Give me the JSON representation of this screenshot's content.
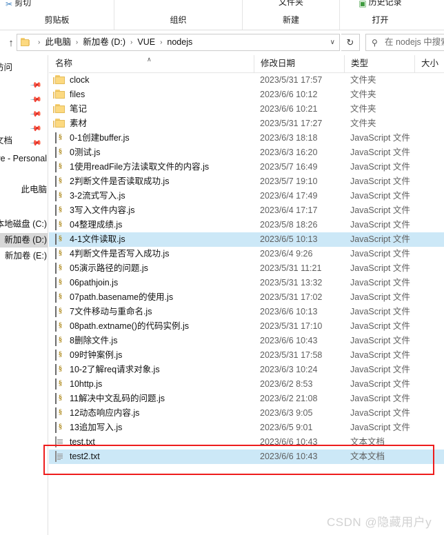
{
  "window": {
    "title": "nodejs"
  },
  "ribbon": {
    "groups": [
      {
        "label": "剪贴板",
        "command": "剪切",
        "icon": "scissors-icon"
      },
      {
        "label": "组织",
        "command": "",
        "icon": ""
      },
      {
        "label": "新建",
        "command": "文件夹",
        "icon": "folder-icon"
      },
      {
        "label": "打开",
        "command": "历史记录",
        "icon": "history-icon"
      }
    ]
  },
  "addressbar": {
    "up_tooltip": "上一级",
    "folder_icon": "folder-icon",
    "crumbs": [
      "此电脑",
      "新加卷 (D:)",
      "VUE",
      "nodejs"
    ],
    "separator": "›",
    "chevron": "∨",
    "refresh_icon": "↻"
  },
  "search": {
    "icon": "search-icon",
    "placeholder": "在 nodejs 中搜索"
  },
  "navpane": {
    "items": [
      {
        "label": "快速访问",
        "pinned": false,
        "selected": false,
        "wide": false
      },
      {
        "label": "",
        "pinned": true,
        "selected": false,
        "wide": false
      },
      {
        "label": "",
        "pinned": true,
        "selected": false,
        "wide": false
      },
      {
        "label": "",
        "pinned": true,
        "selected": false,
        "wide": false
      },
      {
        "label": "",
        "pinned": true,
        "selected": false,
        "wide": false
      },
      {
        "label": "文档",
        "pinned": true,
        "selected": false,
        "wide": false
      },
      {
        "label": "OneDrive - Personal",
        "pinned": false,
        "selected": false,
        "wide": true
      },
      {
        "label": "此电脑",
        "pinned": false,
        "selected": false,
        "wide": true
      },
      {
        "label": "本地磁盘 (C:)",
        "pinned": false,
        "selected": false,
        "wide": true
      },
      {
        "label": "新加卷 (D:)",
        "pinned": false,
        "selected": true,
        "wide": true
      },
      {
        "label": "新加卷 (E:)",
        "pinned": false,
        "selected": false,
        "wide": true
      }
    ]
  },
  "filelist": {
    "columns": [
      "名称",
      "修改日期",
      "类型",
      "大小"
    ],
    "sort_indicator": "∧",
    "rows": [
      {
        "name": "clock",
        "date": "2023/5/31 17:57",
        "type": "文件夹",
        "size": "",
        "icon": "folder-icon",
        "selected": false
      },
      {
        "name": "files",
        "date": "2023/6/6 10:12",
        "type": "文件夹",
        "size": "",
        "icon": "folder-icon",
        "selected": false
      },
      {
        "name": "笔记",
        "date": "2023/6/6 10:21",
        "type": "文件夹",
        "size": "",
        "icon": "folder-icon",
        "selected": false
      },
      {
        "name": "素材",
        "date": "2023/5/31 17:27",
        "type": "文件夹",
        "size": "",
        "icon": "folder-icon",
        "selected": false
      },
      {
        "name": "0-1创建buffer.js",
        "date": "2023/6/3 18:18",
        "type": "JavaScript 文件",
        "size": "",
        "icon": "js-file-icon",
        "selected": false
      },
      {
        "name": "0测试.js",
        "date": "2023/6/3 16:20",
        "type": "JavaScript 文件",
        "size": "",
        "icon": "js-file-icon",
        "selected": false
      },
      {
        "name": "1使用readFile方法读取文件的内容.js",
        "date": "2023/5/7 16:49",
        "type": "JavaScript 文件",
        "size": "",
        "icon": "js-file-icon",
        "selected": false
      },
      {
        "name": "2判断文件是否读取成功.js",
        "date": "2023/5/7 19:10",
        "type": "JavaScript 文件",
        "size": "",
        "icon": "js-file-icon",
        "selected": false
      },
      {
        "name": "3-2流式写入.js",
        "date": "2023/6/4 17:49",
        "type": "JavaScript 文件",
        "size": "",
        "icon": "js-file-icon",
        "selected": false
      },
      {
        "name": "3写入文件内容.js",
        "date": "2023/6/4 17:17",
        "type": "JavaScript 文件",
        "size": "",
        "icon": "js-file-icon",
        "selected": false
      },
      {
        "name": "04整理成绩.js",
        "date": "2023/5/8 18:26",
        "type": "JavaScript 文件",
        "size": "",
        "icon": "js-file-icon",
        "selected": false
      },
      {
        "name": "4-1文件读取.js",
        "date": "2023/6/5 10:13",
        "type": "JavaScript 文件",
        "size": "",
        "icon": "js-file-icon",
        "selected": true
      },
      {
        "name": "4判断文件是否写入成功.js",
        "date": "2023/6/4 9:26",
        "type": "JavaScript 文件",
        "size": "",
        "icon": "js-file-icon",
        "selected": false
      },
      {
        "name": "05演示路径的问题.js",
        "date": "2023/5/31 11:21",
        "type": "JavaScript 文件",
        "size": "",
        "icon": "js-file-icon",
        "selected": false
      },
      {
        "name": "06pathjoin.js",
        "date": "2023/5/31 13:32",
        "type": "JavaScript 文件",
        "size": "",
        "icon": "js-file-icon",
        "selected": false
      },
      {
        "name": "07path.basename的使用.js",
        "date": "2023/5/31 17:02",
        "type": "JavaScript 文件",
        "size": "",
        "icon": "js-file-icon",
        "selected": false
      },
      {
        "name": "7文件移动与重命名.js",
        "date": "2023/6/6 10:13",
        "type": "JavaScript 文件",
        "size": "",
        "icon": "js-file-icon",
        "selected": false
      },
      {
        "name": "08path.extname()的代码实例.js",
        "date": "2023/5/31 17:10",
        "type": "JavaScript 文件",
        "size": "",
        "icon": "js-file-icon",
        "selected": false
      },
      {
        "name": "8删除文件.js",
        "date": "2023/6/6 10:43",
        "type": "JavaScript 文件",
        "size": "",
        "icon": "js-file-icon",
        "selected": false
      },
      {
        "name": "09时钟案例.js",
        "date": "2023/5/31 17:58",
        "type": "JavaScript 文件",
        "size": "",
        "icon": "js-file-icon",
        "selected": false
      },
      {
        "name": "10-2了解req请求对象.js",
        "date": "2023/6/3 10:24",
        "type": "JavaScript 文件",
        "size": "",
        "icon": "js-file-icon",
        "selected": false
      },
      {
        "name": "10http.js",
        "date": "2023/6/2 8:53",
        "type": "JavaScript 文件",
        "size": "",
        "icon": "js-file-icon",
        "selected": false
      },
      {
        "name": "11解决中文乱码的问题.js",
        "date": "2023/6/2 21:08",
        "type": "JavaScript 文件",
        "size": "",
        "icon": "js-file-icon",
        "selected": false
      },
      {
        "name": "12动态响应内容.js",
        "date": "2023/6/3 9:05",
        "type": "JavaScript 文件",
        "size": "",
        "icon": "js-file-icon",
        "selected": false
      },
      {
        "name": "13追加写入.js",
        "date": "2023/6/5 9:01",
        "type": "JavaScript 文件",
        "size": "",
        "icon": "js-file-icon",
        "selected": false
      },
      {
        "name": "test.txt",
        "date": "2023/6/6 10:43",
        "type": "文本文档",
        "size": "",
        "icon": "text-file-icon",
        "selected": false
      },
      {
        "name": "test2.txt",
        "date": "2023/6/6 10:43",
        "type": "文本文档",
        "size": "",
        "icon": "text-file-icon",
        "selected": true
      }
    ]
  },
  "annotation": {
    "highlight_color": "#ee1c1c",
    "selection_color": "#cce8f7"
  },
  "watermark": {
    "text": "CSDN @隐藏用户y"
  }
}
